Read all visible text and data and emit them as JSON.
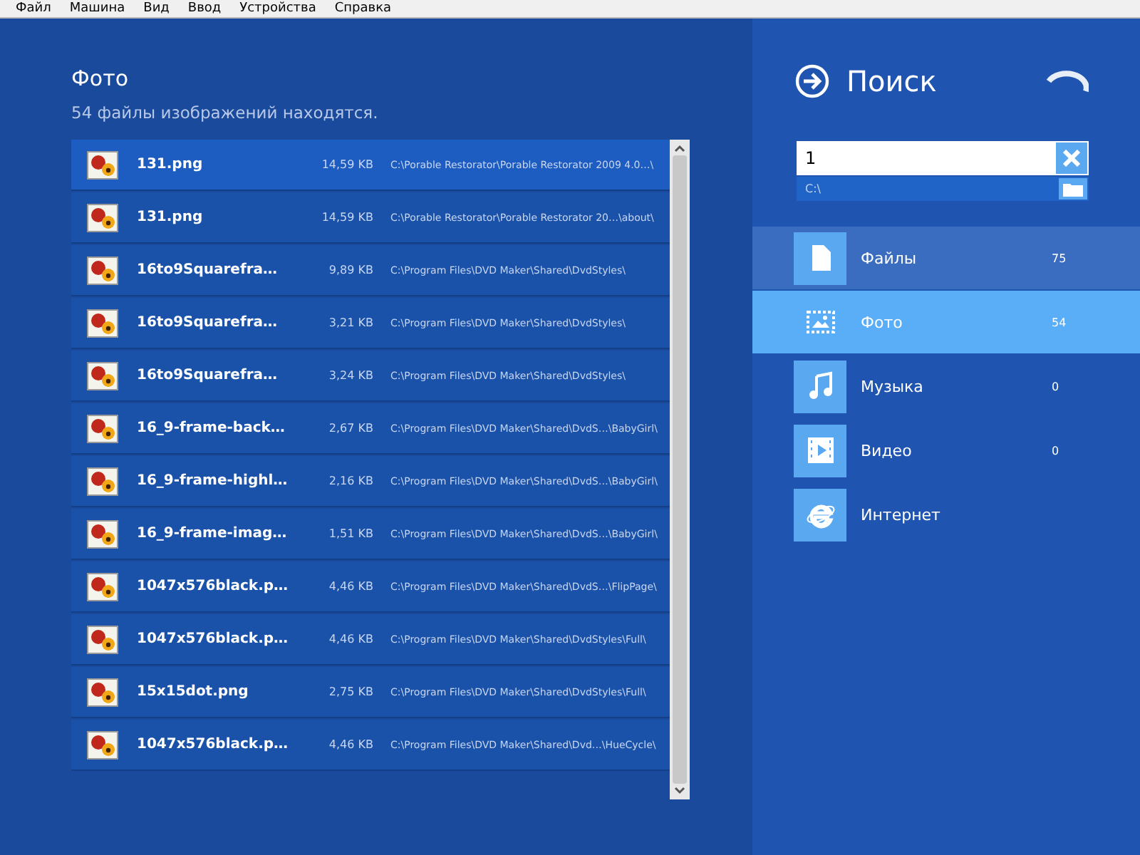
{
  "menu": [
    "Файл",
    "Машина",
    "Вид",
    "Ввод",
    "Устройства",
    "Справка"
  ],
  "results": {
    "title": "Фото",
    "summary": "54 файлы изображений находятся.",
    "rows": [
      {
        "name": "131.png",
        "size": "14,59 KB",
        "path": "C:\\Porable Restorator\\Porable Restorator 2009 4.0…\\",
        "selected": true
      },
      {
        "name": "131.png",
        "size": "14,59 KB",
        "path": "C:\\Porable Restorator\\Porable Restorator 20…\\about\\",
        "selected": false
      },
      {
        "name": "16to9Squarefra…",
        "size": "9,89 KB",
        "path": "C:\\Program Files\\DVD Maker\\Shared\\DvdStyles\\",
        "selected": false
      },
      {
        "name": "16to9Squarefra…",
        "size": "3,21 KB",
        "path": "C:\\Program Files\\DVD Maker\\Shared\\DvdStyles\\",
        "selected": false
      },
      {
        "name": "16to9Squarefra…",
        "size": "3,24 KB",
        "path": "C:\\Program Files\\DVD Maker\\Shared\\DvdStyles\\",
        "selected": false
      },
      {
        "name": "16_9-frame-back…",
        "size": "2,67 KB",
        "path": "C:\\Program Files\\DVD Maker\\Shared\\DvdS…\\BabyGirl\\",
        "selected": false
      },
      {
        "name": "16_9-frame-highl…",
        "size": "2,16 KB",
        "path": "C:\\Program Files\\DVD Maker\\Shared\\DvdS…\\BabyGirl\\",
        "selected": false
      },
      {
        "name": "16_9-frame-imag…",
        "size": "1,51 KB",
        "path": "C:\\Program Files\\DVD Maker\\Shared\\DvdS…\\BabyGirl\\",
        "selected": false
      },
      {
        "name": "1047x576black.p…",
        "size": "4,46 KB",
        "path": "C:\\Program Files\\DVD Maker\\Shared\\DvdS…\\FlipPage\\",
        "selected": false
      },
      {
        "name": "1047x576black.p…",
        "size": "4,46 KB",
        "path": "C:\\Program Files\\DVD Maker\\Shared\\DvdStyles\\Full\\",
        "selected": false
      },
      {
        "name": "15x15dot.png",
        "size": "2,75 KB",
        "path": "C:\\Program Files\\DVD Maker\\Shared\\DvdStyles\\Full\\",
        "selected": false
      },
      {
        "name": "1047x576black.p…",
        "size": "4,46 KB",
        "path": "C:\\Program Files\\DVD Maker\\Shared\\Dvd…\\HueCycle\\",
        "selected": false
      }
    ]
  },
  "search": {
    "title": "Поиск",
    "value": "1",
    "location": "C:\\"
  },
  "categories": [
    {
      "kind": "file",
      "label": "Файлы",
      "count": "75",
      "selected": false,
      "hovered": true
    },
    {
      "kind": "photo",
      "label": "Фото",
      "count": "54",
      "selected": true,
      "hovered": false
    },
    {
      "kind": "music",
      "label": "Музыка",
      "count": "0",
      "selected": false,
      "hovered": false
    },
    {
      "kind": "video",
      "label": "Видео",
      "count": "0",
      "selected": false,
      "hovered": false
    },
    {
      "kind": "internet",
      "label": "Интернет",
      "selected": false,
      "hovered": false
    }
  ]
}
